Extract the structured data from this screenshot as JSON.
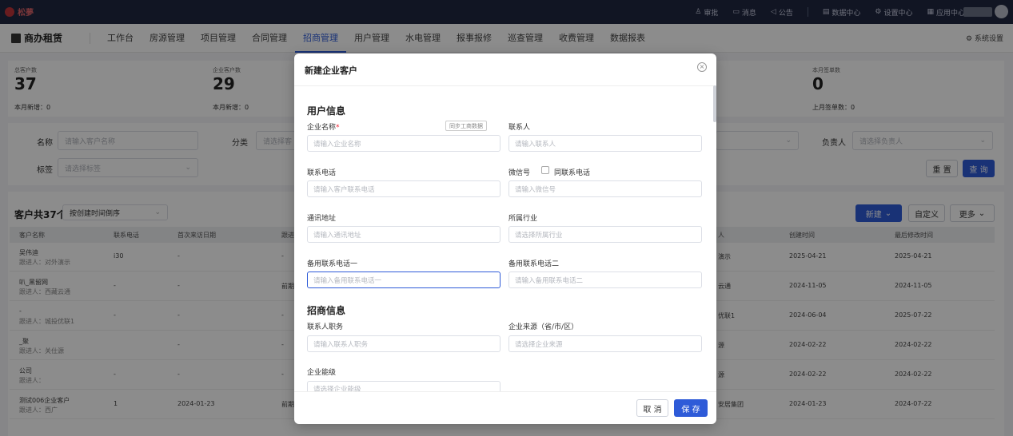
{
  "topbar": {
    "logo": "松夢",
    "items": [
      "审批",
      "消息",
      "公告",
      "数据中心",
      "设置中心",
      "应用中心"
    ]
  },
  "navbar": {
    "brand": "商办租赁",
    "menus": [
      "工作台",
      "房源管理",
      "项目管理",
      "合同管理",
      "招商管理",
      "用户管理",
      "水电管理",
      "报事报修",
      "巡查管理",
      "收费管理",
      "数据报表"
    ],
    "active_menu": "招商管理",
    "system_settings": "系统设置"
  },
  "stats": {
    "total_label": "总客户数",
    "total_value": "37",
    "total_sub": "本月新增：0",
    "enterprise_label": "企业客户数",
    "enterprise_value": "29",
    "enterprise_sub": "本月新增：0",
    "signed_label": "本月签单数",
    "signed_value": "0",
    "signed_sub": "上月签单数：0"
  },
  "filters": {
    "name_label": "名称",
    "name_placeholder": "请输入客户名称",
    "category_label": "分类",
    "category_placeholder": "请选择客",
    "owner_label": "负责人",
    "owner_placeholder": "请选择负责人",
    "tag_label": "标签",
    "tag_placeholder": "请选择标签",
    "reset": "重 置",
    "search": "查 询"
  },
  "list": {
    "count_text": "客户共37个",
    "sort": "按创建时间倒序",
    "new_btn": "新建",
    "custom_btn": "自定义",
    "more_btn": "更多",
    "columns": [
      "客户名称",
      "联系电话",
      "首次来访日期",
      "跟进",
      "人",
      "创建时间",
      "最后修改时间"
    ],
    "rows": [
      {
        "name": "吴伟迪",
        "follow": "跟进人：对外演示",
        "phone": "i30",
        "first": "-",
        "c4": "-",
        "owner": "演示",
        "created": "2025-04-21",
        "modified": "2025-04-21"
      },
      {
        "name": "叭_黑留网",
        "follow": "跟进人：西藏云通",
        "phone": "-",
        "first": "-",
        "c4": "前期",
        "owner": "云通",
        "created": "2024-11-05",
        "modified": "2024-11-05"
      },
      {
        "name": "-",
        "follow": "跟进人：城投优联1",
        "phone": "-",
        "first": "-",
        "c4": "-",
        "owner": "优联1",
        "created": "2024-06-04",
        "modified": "2025-07-22"
      },
      {
        "name": "_聚",
        "follow": "跟进人：关仕源",
        "phone": "",
        "first": "-",
        "c4": "-",
        "owner": "源",
        "created": "2024-02-22",
        "modified": "2024-02-22"
      },
      {
        "name": "公司",
        "follow": "跟进人：",
        "phone": "-",
        "first": "-",
        "c4": "-",
        "owner": "源",
        "created": "2024-02-22",
        "modified": "2024-02-22"
      },
      {
        "name": "测试006企业客户",
        "follow": "跟进人：西广",
        "phone": "1",
        "first": "2024-01-23",
        "c4": "前期",
        "owner": "安居集团",
        "created": "2024-01-23",
        "modified": "2024-07-22"
      }
    ]
  },
  "modal": {
    "title": "新建企业客户",
    "section_user": "用户信息",
    "company_label": "企业名称",
    "company_required": "*",
    "sync_btn": "同步工商数据",
    "company_placeholder": "请输入企业名称",
    "contact_label": "联系人",
    "contact_placeholder": "请输入联系人",
    "phone_label": "联系电话",
    "phone_placeholder": "请输入客户联系电话",
    "wechat_label": "微信号",
    "same_phone_label": "同联系电话",
    "wechat_placeholder": "请输入微信号",
    "address_label": "通讯地址",
    "address_placeholder": "请输入通讯地址",
    "industry_label": "所属行业",
    "industry_placeholder": "请选择所属行业",
    "backup1_label": "备用联系电话一",
    "backup1_placeholder": "请输入备用联系电话一",
    "backup2_label": "备用联系电话二",
    "backup2_placeholder": "请输入备用联系电话二",
    "section_invest": "招商信息",
    "position_label": "联系人职务",
    "position_placeholder": "请输入联系人职务",
    "source_label": "企业来源（省/市/区）",
    "source_placeholder": "请选择企业来源",
    "level_label": "企业能级",
    "level_placeholder": "请选择企业能级",
    "cancel": "取 消",
    "save": "保 存"
  }
}
